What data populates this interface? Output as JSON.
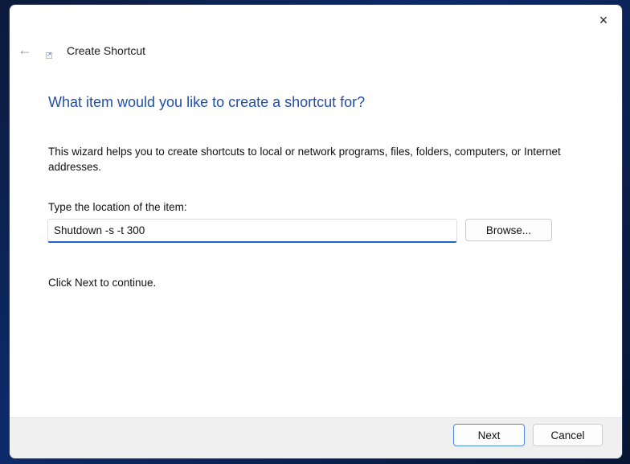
{
  "window": {
    "title": "Create Shortcut"
  },
  "heading": "What item would you like to create a shortcut for?",
  "description": "This wizard helps you to create shortcuts to local or network programs, files, folders, computers, or Internet addresses.",
  "location_label": "Type the location of the item:",
  "location_value": "Shutdown -s -t 300",
  "browse_label": "Browse...",
  "continue_text": "Click Next to continue.",
  "next_label": "Next",
  "cancel_label": "Cancel",
  "icons": {
    "close": "×",
    "back": "←",
    "shortcut": "↗"
  }
}
